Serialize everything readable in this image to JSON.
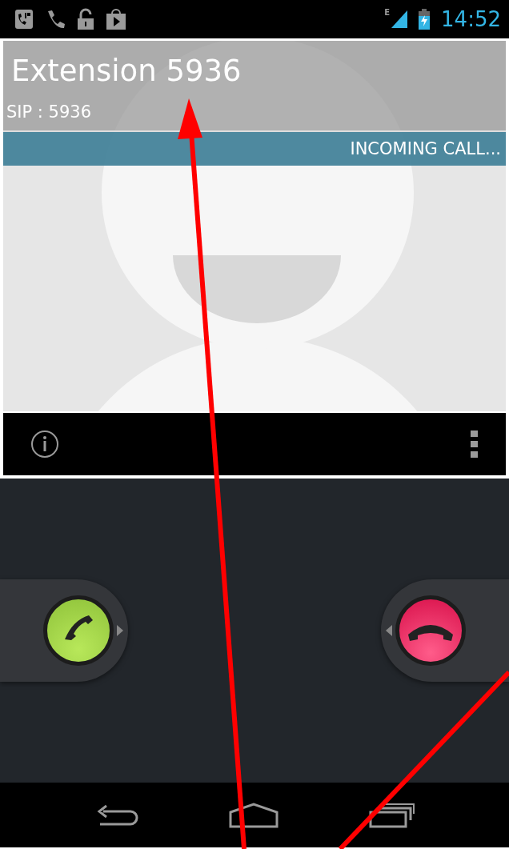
{
  "status_bar": {
    "network": "E",
    "time": "14:52"
  },
  "contact": {
    "name": "Extension 5936",
    "sip": "SIP : 5936",
    "call_state": "INCOMING CALL..."
  }
}
